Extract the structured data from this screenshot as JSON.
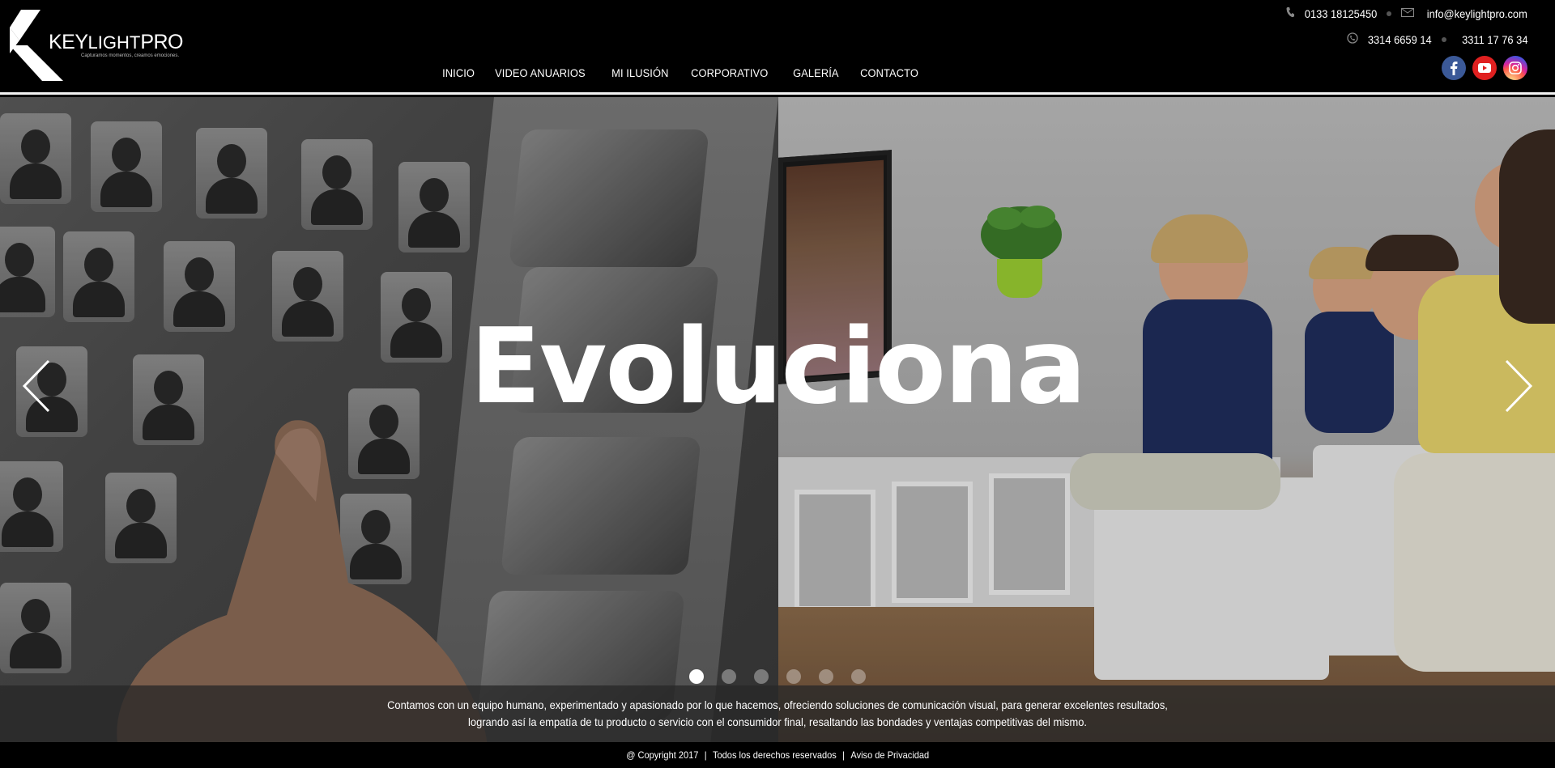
{
  "brand": {
    "name_key": "KEY",
    "name_light": "LIGHT",
    "name_pro": "PRO",
    "tagline": "Capturamos momentos, creamos emociones."
  },
  "nav": {
    "items": [
      {
        "label": "INICIO"
      },
      {
        "label": "VIDEO ANUARIOS"
      },
      {
        "label": "MI ILUSIÓN"
      },
      {
        "label": "CORPORATIVO"
      },
      {
        "label": "GALERÍA"
      },
      {
        "label": "CONTACTO"
      }
    ]
  },
  "contact": {
    "phone": "0133 18125450",
    "email": "info@keylightpro.com",
    "whatsapp1": "3314 6659 14",
    "whatsapp2": "3311 17 76 34",
    "icons": [
      "phone-icon",
      "mail-icon",
      "whatsapp-icon"
    ]
  },
  "social": [
    {
      "name": "facebook-icon",
      "color": "#3b5998"
    },
    {
      "name": "youtube-icon",
      "color": "#e02020"
    },
    {
      "name": "instagram-icon",
      "color": "#d6249f"
    }
  ],
  "hero": {
    "headline": "Evoluciona",
    "slides_total": 6,
    "active_slide": 1,
    "text_line1": "Contamos con un equipo humano, experimentado y apasionado por lo que hacemos, ofreciendo soluciones de comunicación visual, para generar excelentes resultados,",
    "text_line2": "logrando así la empatía de tu producto o servicio con el consumidor final, resaltando las bondades y ventajas competitivas del mismo."
  },
  "footer": {
    "copyright": "@ Copyright 2017",
    "rights": "Todos los derechos reservados",
    "privacy": "Aviso de Privacidad",
    "separator": "|"
  }
}
